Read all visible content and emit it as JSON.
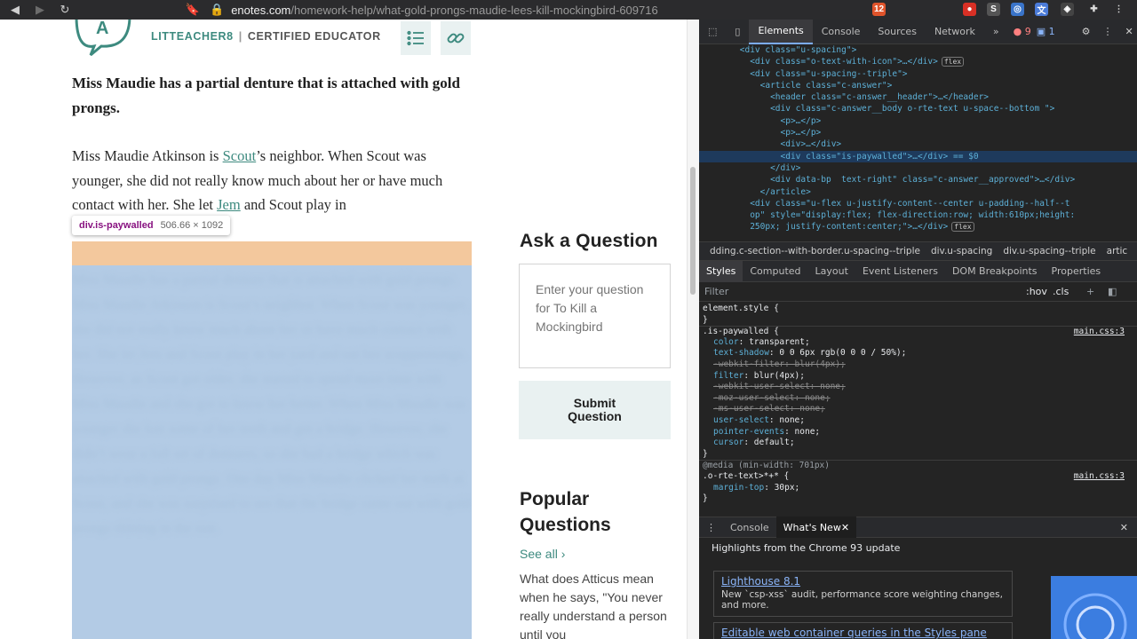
{
  "browser": {
    "url_domain": "enotes.com",
    "url_path": "/homework-help/what-gold-prongs-maudie-lees-kill-mockingbird-609716",
    "brave_badge": "12"
  },
  "article": {
    "author_name": "LITTEACHER8",
    "author_sep": "|",
    "author_role": "CERTIFIED EDUCATOR",
    "lead": "Miss Maudie has a partial denture that is attached with gold prongs.",
    "para_1": "Miss Maudie Atkinson is ",
    "link_scout": "Scout",
    "para_2": "’s neighbor.  When Scout was younger, she did not really know much about her or have much contact with her.  She let ",
    "link_jem": "Jem",
    "para_3": " and Scout play in",
    "tooltip_selector": "div.is-paywalled",
    "tooltip_dims": "506.66 × 1092",
    "blurred_text": "Miss Maudie has a partial denture that is attached with gold prongs. Miss Maudie Atkinson is Scout’s neighbor. When Scout was younger, she did not really know much about her or have much contact with her. She let Jem and Scout play in her yard and eat her scuppernongs. However, as Scout got older, she started to spend more time with Miss Maudie and she got to know her better. When Miss Maudie was younger she lost some of her teeth and got a bridge. However, she didn’t wear a full set of dentures, so she had a bridge which was attached with gold prongs. One day Miss Maudie clicked her teeth at Scout, and she was surprised to see that the bridge came out with gold prongs shining in the sun."
  },
  "sidebar": {
    "ask_title": "Ask a Question",
    "ask_placeholder": "Enter your question for To Kill a Mockingbird",
    "submit_label": "Submit Question",
    "popular_title": "Popular Questions",
    "see_all": "See all",
    "popular_q": "What does Atticus mean when he says, \"You never really understand a person until you"
  },
  "devtools": {
    "tabs": [
      "Elements",
      "Console",
      "Sources",
      "Network"
    ],
    "more": "»",
    "errors": "9",
    "messages": "1",
    "dom_lines": [
      {
        "indent": "        ",
        "text": "<div class=\"u-spacing\">"
      },
      {
        "indent": "          ",
        "text": "<div class=\"o-text-with-icon\">…</div>",
        "badge": "flex"
      },
      {
        "indent": "          ",
        "text": "<div class=\"u-spacing--triple\">"
      },
      {
        "indent": "            ",
        "text": "<article class=\"c-answer\">"
      },
      {
        "indent": "              ",
        "text": "<header class=\"c-answer__header\">…</header>"
      },
      {
        "indent": "              ",
        "text": "<div class=\"c-answer__body o-rte-text u-space--bottom \">"
      },
      {
        "indent": "                ",
        "text": "<p>…</p>"
      },
      {
        "indent": "                ",
        "text": "<p>…</p>"
      },
      {
        "indent": "                ",
        "text": "<div>…</div>"
      },
      {
        "indent": "                ",
        "text": "<div class=\"is-paywalled\">…</div> == $0",
        "selected": true
      },
      {
        "indent": "              ",
        "text": "</div>"
      },
      {
        "indent": "              ",
        "text": "<div data-bp  text-right\" class=\"c-answer__approved\">…</div>"
      },
      {
        "indent": "            ",
        "text": "</article>"
      },
      {
        "indent": "          ",
        "text": "<div class=\"u-flex u-justify-content--center u-padding--half--t"
      },
      {
        "indent": "          ",
        "text": "op\" style=\"display:flex; flex-direction:row; width:610px;height:"
      },
      {
        "indent": "          ",
        "text": "250px; justify-content:center;\">…</div>",
        "badge": "flex"
      }
    ],
    "breadcrumbs": [
      "dding.c-section--with-border.u-spacing--triple",
      "div.u-spacing",
      "div.u-spacing--triple",
      "artic"
    ],
    "style_tabs": [
      "Styles",
      "Computed",
      "Layout",
      "Event Listeners",
      "DOM Breakpoints",
      "Properties"
    ],
    "filter_label": "Filter",
    "hov": ":hov",
    "cls": ".cls",
    "css_rules": {
      "element_style": "element.style {",
      "close": "}",
      "selector": ".is-paywalled {",
      "source": "main.css:3",
      "props": [
        {
          "name": "color",
          "value": "transparent;",
          "strike": false
        },
        {
          "name": "text-shadow",
          "value": "0 0 6px rgb(0 0 0 / 50%);",
          "strike": false
        },
        {
          "name": "-webkit-filter",
          "value": "blur(4px);",
          "strike": true
        },
        {
          "name": "filter",
          "value": "blur(4px);",
          "strike": false
        },
        {
          "name": "-webkit-user-select",
          "value": "none;",
          "strike": true
        },
        {
          "name": "-moz-user-select",
          "value": "none;",
          "strike": true
        },
        {
          "name": "-ms-user-select",
          "value": "none;",
          "strike": true
        },
        {
          "name": "user-select",
          "value": "none;",
          "strike": false
        },
        {
          "name": "pointer-events",
          "value": "none;",
          "strike": false
        },
        {
          "name": "cursor",
          "value": "default;",
          "strike": false
        }
      ],
      "media": "@media (min-width: 701px)",
      "media_selector": ".o-rte-text>*+* {",
      "media_prop": {
        "name": "margin-top",
        "value": "30px;"
      }
    },
    "drawer_tabs": [
      "Console",
      "What's New"
    ],
    "whatsnew_head": "Highlights from the Chrome 93 update",
    "cards": [
      {
        "title": "Lighthouse 8.1",
        "desc": "New `csp-xss` audit, performance score weighting changes, and more."
      },
      {
        "title": "Editable web container queries in the Styles pane",
        "desc": ""
      }
    ]
  },
  "colors": {
    "accent": "#3d8a7f",
    "paywall_overlay": "#b3cbe5",
    "margin_overlay": "#f3c89d",
    "devtools_bg": "#242424"
  }
}
